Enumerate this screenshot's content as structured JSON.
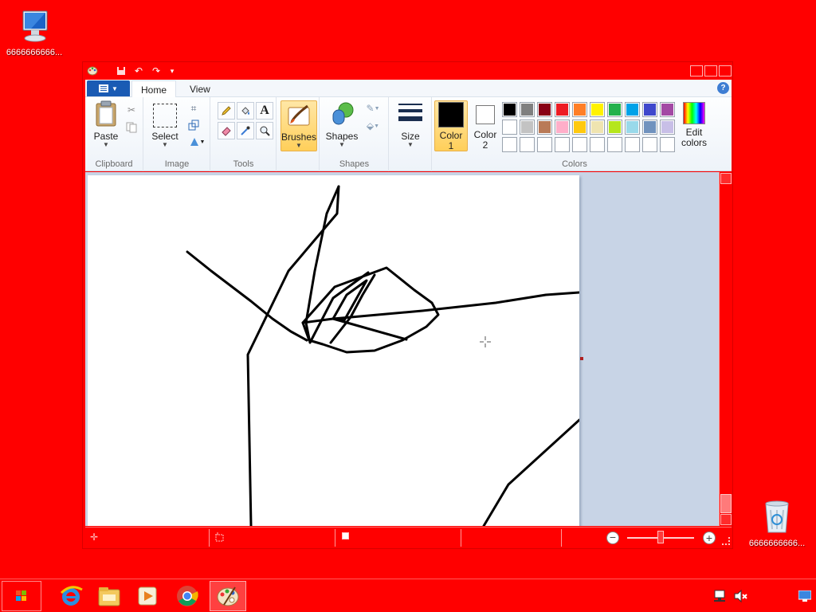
{
  "desktop": {
    "computer_label": "6666666666...",
    "recycle_label": "6666666666..."
  },
  "window": {
    "quick_access": [
      "save-icon",
      "undo-icon",
      "redo-icon",
      "customize-icon"
    ]
  },
  "tabs": {
    "home": "Home",
    "view": "View"
  },
  "ribbon": {
    "clipboard": {
      "paste": "Paste",
      "group": "Clipboard"
    },
    "image": {
      "select": "Select",
      "group": "Image"
    },
    "tools": {
      "group": "Tools"
    },
    "brushes": {
      "label": "Brushes"
    },
    "shapes": {
      "label": "Shapes",
      "group": "Shapes"
    },
    "size": {
      "label": "Size"
    },
    "colors": {
      "color1_a": "Color",
      "color1_b": "1",
      "color2_a": "Color",
      "color2_b": "2",
      "edit_a": "Edit",
      "edit_b": "colors",
      "group": "Colors",
      "color1_value": "#000000",
      "color2_value": "#ffffff",
      "palette": [
        [
          "#000000",
          "#7f7f7f",
          "#880015",
          "#ed1c24",
          "#ff7f27",
          "#fff200",
          "#22b14c",
          "#00a2e8",
          "#3f48cc",
          "#a349a4"
        ],
        [
          "#ffffff",
          "#c3c3c3",
          "#b97a57",
          "#ffaec9",
          "#ffc90e",
          "#efe4b0",
          "#b5e61d",
          "#99d9ea",
          "#7092be",
          "#c8bfe7"
        ],
        [
          "#ffffff",
          "#ffffff",
          "#ffffff",
          "#ffffff",
          "#ffffff",
          "#ffffff",
          "#ffffff",
          "#ffffff",
          "#ffffff",
          "#ffffff"
        ]
      ]
    }
  },
  "theme": {
    "desktop": "#ff0000",
    "accent": "#1a5bb4"
  }
}
